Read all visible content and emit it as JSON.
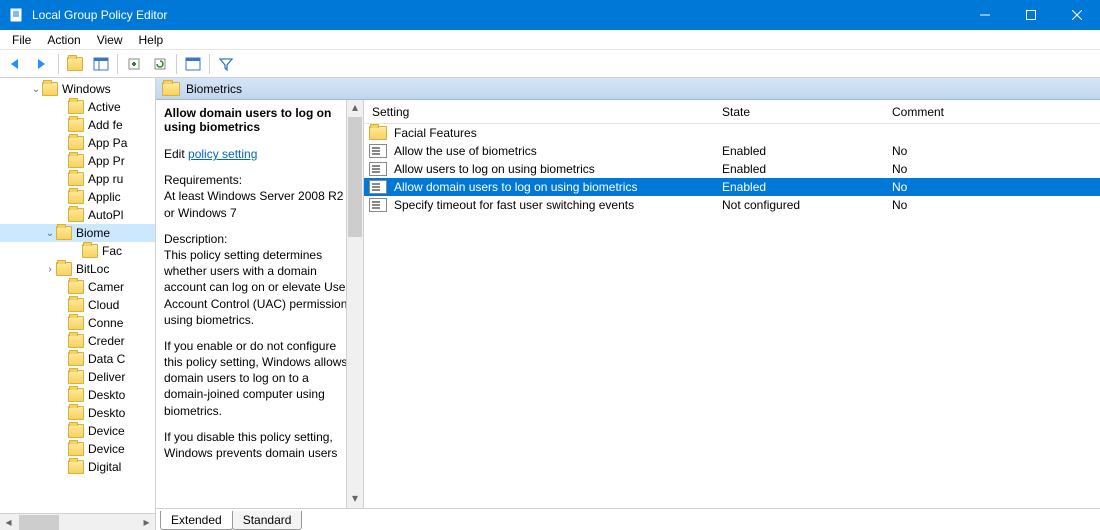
{
  "window": {
    "title": "Local Group Policy Editor"
  },
  "menu": {
    "file": "File",
    "action": "Action",
    "view": "View",
    "help": "Help"
  },
  "crumb": {
    "label": "Biometrics"
  },
  "tree": {
    "items": [
      {
        "indent": 30,
        "twist": "⌄",
        "label": "Windows"
      },
      {
        "indent": 56,
        "twist": "",
        "label": "Active"
      },
      {
        "indent": 56,
        "twist": "",
        "label": "Add fe"
      },
      {
        "indent": 56,
        "twist": "",
        "label": "App Pa"
      },
      {
        "indent": 56,
        "twist": "",
        "label": "App Pr"
      },
      {
        "indent": 56,
        "twist": "",
        "label": "App ru"
      },
      {
        "indent": 56,
        "twist": "",
        "label": "Applic"
      },
      {
        "indent": 56,
        "twist": "",
        "label": "AutoPl"
      },
      {
        "indent": 44,
        "twist": "⌄",
        "label": "Biome",
        "sel": true
      },
      {
        "indent": 70,
        "twist": "",
        "label": "Fac"
      },
      {
        "indent": 44,
        "twist": "›",
        "label": "BitLoc"
      },
      {
        "indent": 56,
        "twist": "",
        "label": "Camer"
      },
      {
        "indent": 56,
        "twist": "",
        "label": "Cloud"
      },
      {
        "indent": 56,
        "twist": "",
        "label": "Conne"
      },
      {
        "indent": 56,
        "twist": "",
        "label": "Creder"
      },
      {
        "indent": 56,
        "twist": "",
        "label": "Data C"
      },
      {
        "indent": 56,
        "twist": "",
        "label": "Deliver"
      },
      {
        "indent": 56,
        "twist": "",
        "label": "Deskto"
      },
      {
        "indent": 56,
        "twist": "",
        "label": "Deskto"
      },
      {
        "indent": 56,
        "twist": "",
        "label": "Device"
      },
      {
        "indent": 56,
        "twist": "",
        "label": "Device"
      },
      {
        "indent": 56,
        "twist": "",
        "label": "Digital"
      }
    ]
  },
  "desc": {
    "title": "Allow domain users to log on using biometrics",
    "edit_prefix": "Edit ",
    "edit_link": "policy setting ",
    "req_label": "Requirements:",
    "req_text": "At least Windows Server 2008 R2 or Windows 7",
    "d_label": "Description:",
    "d_p1": "This policy setting determines whether users with a domain account can log on or elevate User Account Control (UAC) permissions using biometrics.",
    "d_p2": "If you enable or do not configure this policy setting, Windows allows domain users to log on to a domain-joined computer using biometrics.",
    "d_p3": "If you disable this policy setting, Windows prevents domain users"
  },
  "grid": {
    "headers": {
      "setting": "Setting",
      "state": "State",
      "comment": "Comment"
    },
    "rows": [
      {
        "type": "folder",
        "setting": "Facial Features",
        "state": "",
        "comment": ""
      },
      {
        "type": "item",
        "setting": "Allow the use of biometrics",
        "state": "Enabled",
        "comment": "No"
      },
      {
        "type": "item",
        "setting": "Allow users to log on using biometrics",
        "state": "Enabled",
        "comment": "No"
      },
      {
        "type": "item",
        "setting": "Allow domain users to log on using biometrics",
        "state": "Enabled",
        "comment": "No",
        "sel": true
      },
      {
        "type": "item",
        "setting": "Specify timeout for fast user switching events",
        "state": "Not configured",
        "comment": "No"
      }
    ]
  },
  "tabs": {
    "extended": "Extended",
    "standard": "Standard"
  }
}
